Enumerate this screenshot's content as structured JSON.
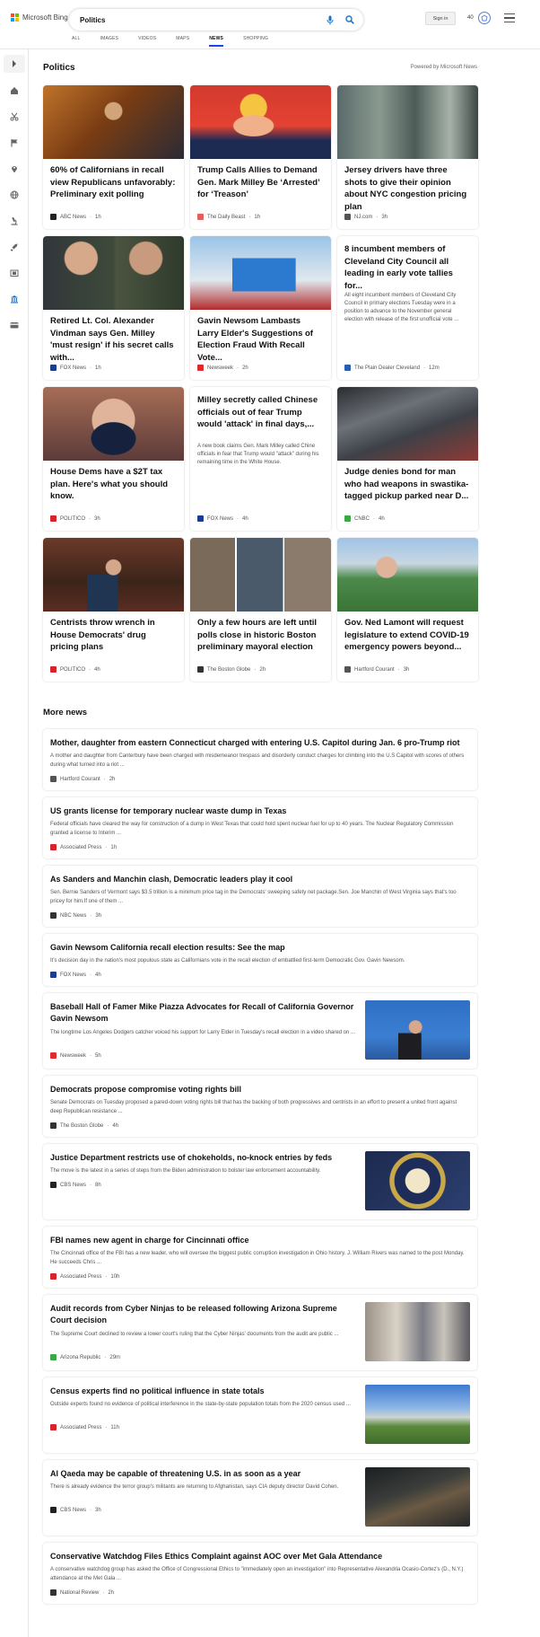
{
  "header": {
    "brand": "Microsoft Bing",
    "query": "Politics",
    "sign_in": "Sign in",
    "points": "40",
    "tabs": [
      {
        "label": "ALL"
      },
      {
        "label": "IMAGES"
      },
      {
        "label": "VIDEOS"
      },
      {
        "label": "MAPS"
      },
      {
        "label": "NEWS",
        "active": true
      },
      {
        "label": "SHOPPING"
      }
    ]
  },
  "sidebar": {
    "icons": [
      "expand-icon",
      "home-icon",
      "scissors-icon",
      "flag-icon",
      "location-pin-icon",
      "globe-icon",
      "microscope-icon",
      "rocket-icon",
      "film-icon",
      "bank-icon",
      "credit-card-icon"
    ]
  },
  "main": {
    "section_title": "Politics",
    "powered_by": "Powered by Microsoft News",
    "cards": [
      {
        "title": "60% of Californians in recall view Republicans unfavorably: Preliminary exit polling",
        "snippet": "",
        "source": "ABC News",
        "age": "1h",
        "logo_color": "#222222"
      },
      {
        "title": "Trump Calls Allies to Demand Gen. Mark Milley Be ‘Arrested’ for ‘Treason’",
        "snippet": "",
        "source": "The Daily Beast",
        "age": "1h",
        "logo_color": "#e85c5c"
      },
      {
        "title": "Jersey drivers have three shots to give their opinion about NYC congestion pricing plan",
        "snippet": "",
        "source": "NJ.com",
        "age": "3h",
        "logo_color": "#555555"
      },
      {
        "title": "Retired Lt. Col. Alexander Vindman says Gen. Milley 'must resign' if his secret calls with...",
        "snippet": "",
        "source": "FOX News",
        "age": "1h",
        "logo_color": "#1b3d8f"
      },
      {
        "title": "Gavin Newsom Lambasts Larry Elder's Suggestions of Election Fraud With Recall Vote...",
        "snippet": "",
        "source": "Newsweek",
        "age": "2h",
        "logo_color": "#e0282e"
      },
      {
        "title": "8 incumbent members of Cleveland City Council all leading in early vote tallies for...",
        "snippet": "All eight incumbent members of Cleveland City Council in primary elections Tuesday were in a position to advance to the November general election with release of the first unofficial vote ...",
        "source": "The Plain Dealer Cleveland",
        "age": "12m",
        "logo_color": "#2a5db0"
      },
      {
        "title": "House Dems have a $2T tax plan. Here's what you should know.",
        "snippet": "",
        "source": "POLITICO",
        "age": "3h",
        "logo_color": "#d8232a"
      },
      {
        "title": "Milley secretly called Chinese officials out of fear Trump would 'attack' in final days,...",
        "snippet": "A new book claims Gen. Mark Milley called Chine officials in fear that Trump would \"attack\" during his remaining time in the White House.",
        "source": "FOX News",
        "age": "4h",
        "logo_color": "#1b3d8f"
      },
      {
        "title": "Judge denies bond for man who had weapons in swastika-tagged pickup parked near D...",
        "snippet": "",
        "source": "CNBC",
        "age": "4h",
        "logo_color": "#3aa845"
      },
      {
        "title": "Centrists throw wrench in House Democrats' drug pricing plans",
        "snippet": "",
        "source": "POLITICO",
        "age": "4h",
        "logo_color": "#d8232a"
      },
      {
        "title": "Only a few hours are left until polls close in historic Boston preliminary mayoral election",
        "snippet": "",
        "source": "The Boston Globe",
        "age": "2h",
        "logo_color": "#333333"
      },
      {
        "title": "Gov. Ned Lamont will request legislature to extend COVID-19 emergency powers beyond...",
        "snippet": "",
        "source": "Hartford Courant",
        "age": "3h",
        "logo_color": "#555555"
      }
    ],
    "more_news_title": "More news",
    "more_news": [
      {
        "title": "Mother, daughter from eastern Connecticut charged with entering U.S. Capitol during Jan. 6 pro-Trump riot",
        "snippet": "A mother and daughter from Canterbury have been charged with misdemeanor trespass and disorderly conduct charges for climbing into the U.S Capitol with scores of others during what turned into a riot ...",
        "source": "Hartford Courant",
        "age": "2h",
        "logo_color": "#555555"
      },
      {
        "title": "US grants license for temporary nuclear waste dump in Texas",
        "snippet": "Federal officials have cleared the way for construction of a dump in West Texas that could hold spent nuclear fuel for up to 40 years. The Nuclear Regulatory Commission granted a license to Interim ...",
        "source": "Associated Press",
        "age": "1h",
        "logo_color": "#d8232a"
      },
      {
        "title": "As Sanders and Manchin clash, Democratic leaders play it cool",
        "snippet": "Sen. Bernie Sanders of Vermont says $3.5 trillion is a minimum price tag in the Democrats' sweeping safety net package.Sen. Joe Manchin of West Virginia says that's too pricey for him.If one of them ...",
        "source": "NBC News",
        "age": "3h",
        "logo_color": "#333333"
      },
      {
        "title": "Gavin Newsom California recall election results: See the map",
        "snippet": "It's decision day in the nation's most populous state as Californians vote in the recall election of embattled first-term Democratic Gov. Gavin Newsom.",
        "source": "FOX News",
        "age": "4h",
        "logo_color": "#1b3d8f"
      },
      {
        "title": "Baseball Hall of Famer Mike Piazza Advocates for Recall of California Governor Gavin Newsom",
        "snippet": "The longtime Los Angeles Dodgers catcher voiced his support for Larry Elder in Tuesday's recall election in a video shared on ...",
        "source": "Newsweek",
        "age": "5h",
        "logo_color": "#e0282e"
      },
      {
        "title": "Democrats propose compromise voting rights bill",
        "snippet": "Senate Democrats on Tuesday proposed a pared-down voting rights bill that has the backing of both progressives and centrists in an effort to present a united front against deep Republican resistance ...",
        "source": "The Boston Globe",
        "age": "4h",
        "logo_color": "#333333"
      },
      {
        "title": "Justice Department restricts use of chokeholds, no-knock entries by feds",
        "snippet": "The move is the latest in a series of steps from the Biden administration to bolster law enforcement accountability.",
        "source": "CBS News",
        "age": "8h",
        "logo_color": "#222222"
      },
      {
        "title": "FBI names new agent in charge for Cincinnati office",
        "snippet": "The Cincinnati office of the FBI has a new leader, who will oversee the biggest public corruption investigation in Ohio history. J. William Rivers was named to the post Monday. He succeeds Chris ...",
        "source": "Associated Press",
        "age": "10h",
        "logo_color": "#d8232a"
      },
      {
        "title": "Audit records from Cyber Ninjas to be released following Arizona Supreme Court decision",
        "snippet": "The Supreme Court declined to review a lower court's ruling that the Cyber Ninjas' documents from the audit are public ...",
        "source": "Arizona Republic",
        "age": "29m",
        "logo_color": "#3aa845"
      },
      {
        "title": "Census experts find no political influence in state totals",
        "snippet": "Outside experts found no evidence of political interference in the state-by-state population totals from the 2020 census used ...",
        "source": "Associated Press",
        "age": "11h",
        "logo_color": "#d8232a"
      },
      {
        "title": "Al Qaeda may be capable of threatening U.S. in as soon as a year",
        "snippet": "There is already evidence the terror group's militants are returning to Afghanistan, says CIA deputy director David Cohen.",
        "source": "CBS News",
        "age": "3h",
        "logo_color": "#222222"
      },
      {
        "title": "Conservative Watchdog Files Ethics Complaint against AOC over Met Gala Attendance",
        "snippet": "A conservative watchdog group has asked the Office of Congressional Ethics to \"immediately open an investigation\" into Representative Alexandria Ocasio-Cortez's (D., N.Y.) attendance at the Met Gala ...",
        "source": "National Review",
        "age": "2h",
        "logo_color": "#333333"
      }
    ]
  }
}
